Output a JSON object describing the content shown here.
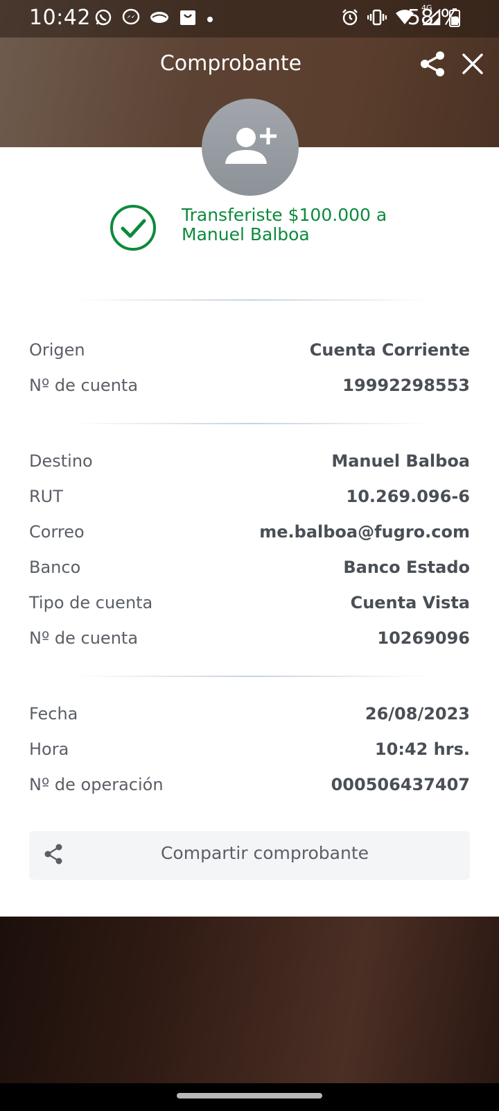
{
  "status_bar": {
    "time": "10:42",
    "battery_text": "58 %",
    "network_label": "4G",
    "icons": [
      "whatsapp-icon",
      "messenger-icon",
      "app-icon",
      "shopping-bag-icon",
      "dot-icon",
      "alarm-icon",
      "vibrate-icon",
      "wifi-icon",
      "signal-icon",
      "battery-icon"
    ]
  },
  "header": {
    "title": "Comprobante",
    "share_icon": "share-icon",
    "close_icon": "close-icon"
  },
  "avatar": {
    "icon": "add-contact-icon"
  },
  "success": {
    "icon": "check-circle-icon",
    "message": "Transferiste $100.000 a Manuel Balboa",
    "color": "#0c8a3c"
  },
  "origin_section": {
    "rows": [
      {
        "label": "Origen",
        "value": "Cuenta Corriente"
      },
      {
        "label": "Nº de cuenta",
        "value": "19992298553"
      }
    ]
  },
  "destination_section": {
    "rows": [
      {
        "label": "Destino",
        "value": "Manuel Balboa"
      },
      {
        "label": "RUT",
        "value": "10.269.096-6"
      },
      {
        "label": "Correo",
        "value": "me.balboa@fugro.com"
      },
      {
        "label": "Banco",
        "value": "Banco Estado"
      },
      {
        "label": "Tipo de cuenta",
        "value": "Cuenta Vista"
      },
      {
        "label": "Nº de cuenta",
        "value": "10269096"
      }
    ]
  },
  "operation_section": {
    "rows": [
      {
        "label": "Fecha",
        "value": "26/08/2023"
      },
      {
        "label": "Hora",
        "value": "10:42 hrs."
      },
      {
        "label": "Nº de operación",
        "value": "000506437407"
      }
    ]
  },
  "share_button": {
    "label": "Compartir comprobante",
    "icon": "share-icon"
  }
}
